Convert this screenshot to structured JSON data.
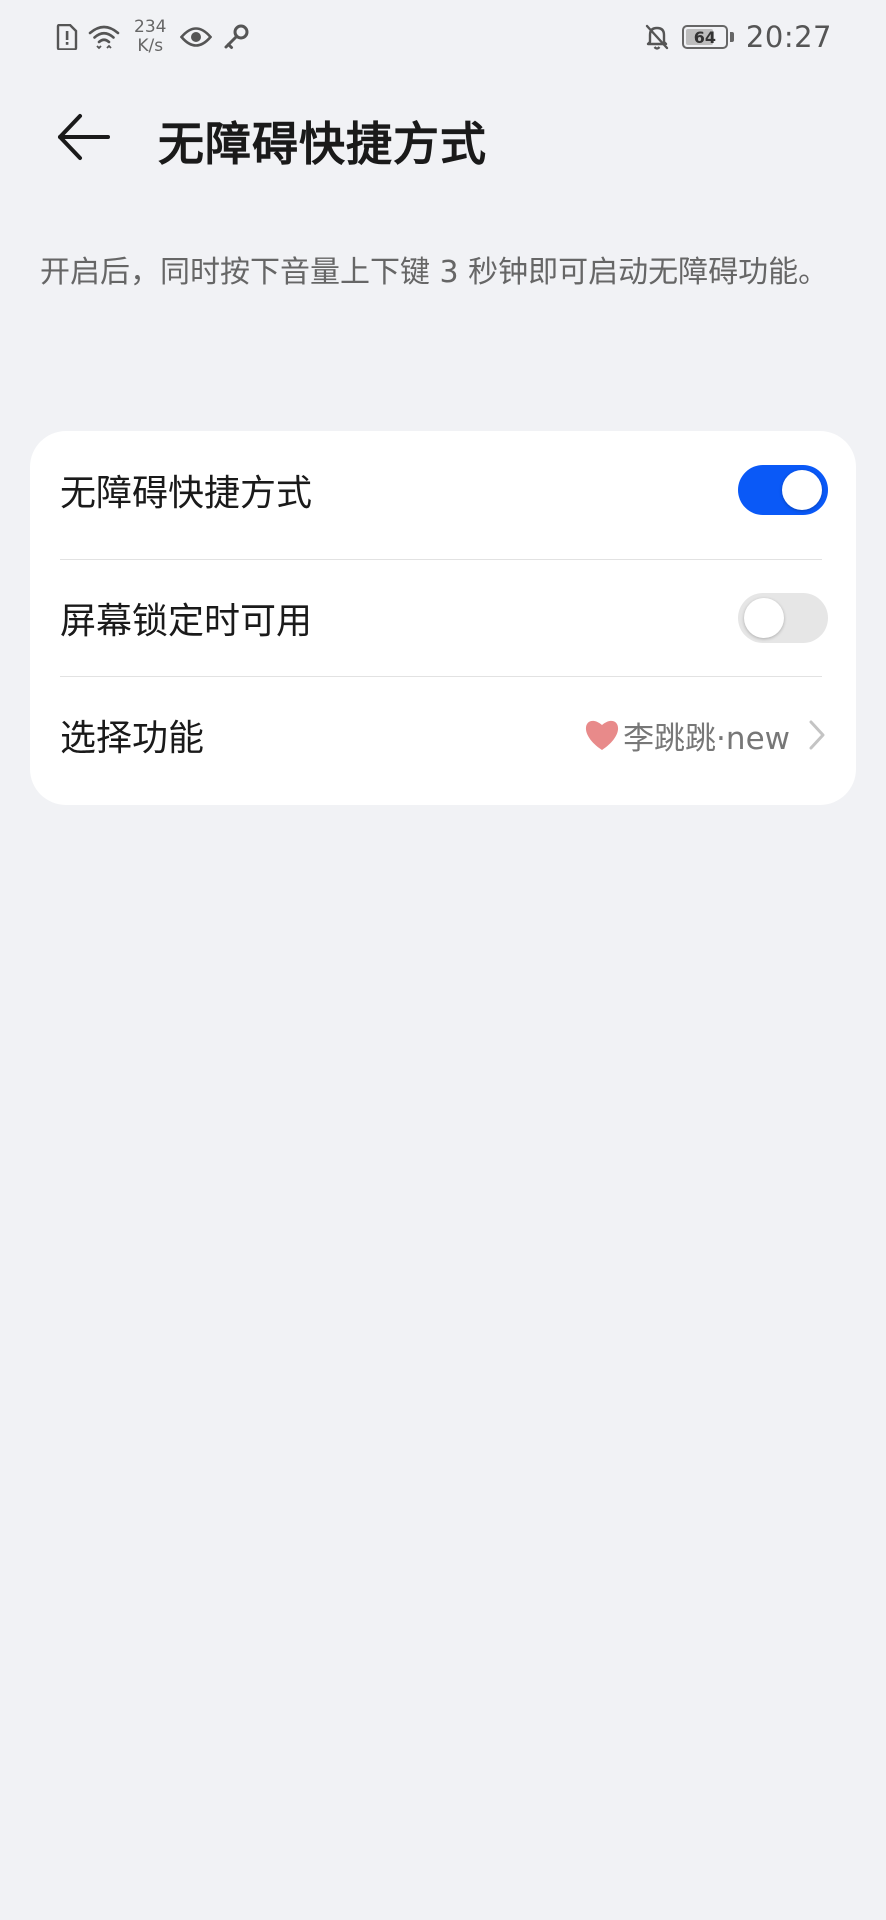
{
  "status_bar": {
    "speed_value": "234",
    "speed_unit": "K/s",
    "battery": "64",
    "time": "20:27",
    "icons": [
      "sim-alert-icon",
      "wifi-icon",
      "eye-icon",
      "key-icon",
      "bell-off-icon",
      "battery-icon"
    ]
  },
  "header": {
    "title": "无障碍快捷方式",
    "back_icon": "back-arrow-icon"
  },
  "description": "开启后，同时按下音量上下键 3 秒钟即可启动无障碍功能。",
  "settings": {
    "shortcut": {
      "label": "无障碍快捷方式",
      "enabled": true
    },
    "lock_screen": {
      "label": "屏幕锁定时可用",
      "enabled": false
    },
    "select_function": {
      "label": "选择功能",
      "value": "李跳跳·new",
      "icon": "heart-icon"
    }
  },
  "colors": {
    "accent": "#0a59f7",
    "background": "#f1f2f5",
    "card": "#ffffff",
    "heart": "#e88a8a"
  }
}
